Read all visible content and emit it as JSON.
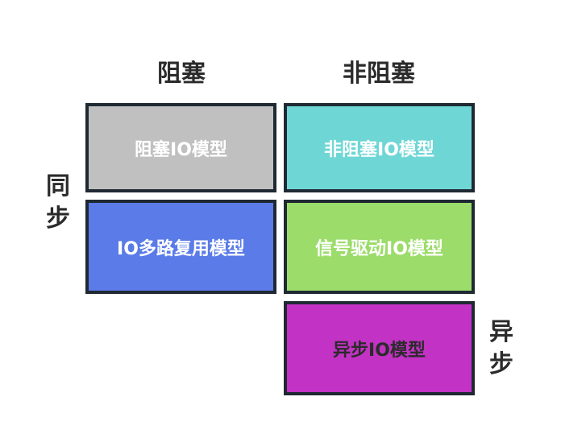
{
  "columns": {
    "blocking": "阻塞",
    "non_blocking": "非阻塞"
  },
  "rows": {
    "sync": [
      "同",
      "步"
    ],
    "async": [
      "异",
      "步"
    ]
  },
  "cells": {
    "blocking_io": {
      "label": "阻塞IO模型",
      "color": "#c0c0c0"
    },
    "non_blocking_io": {
      "label": "非阻塞IO模型",
      "color": "#6fd6d6"
    },
    "io_multiplexing": {
      "label": "IO多路复用模型",
      "color": "#5a7be8"
    },
    "signal_driven_io": {
      "label": "信号驱动IO模型",
      "color": "#9cdc6a"
    },
    "async_io": {
      "label": "异步IO模型",
      "color": "#c232c4"
    }
  }
}
